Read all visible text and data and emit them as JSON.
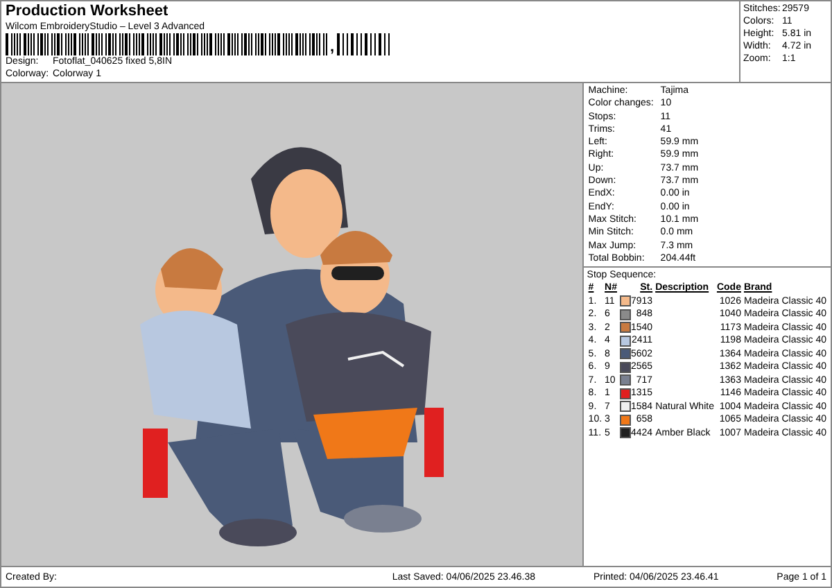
{
  "header": {
    "title": "Production Worksheet",
    "product": "Wilcom EmbroideryStudio – Level 3 Advanced",
    "barcode_separator": ",",
    "fields": [
      {
        "label": "Design:",
        "value": "Fotoflat_040625 fixed 5,8IN"
      },
      {
        "label": "Colorway:",
        "value": "Colorway 1"
      }
    ]
  },
  "summary": [
    {
      "label": "Stitches:",
      "value": "29579"
    },
    {
      "label": "Colors:",
      "value": "11"
    },
    {
      "label": "Height:",
      "value": "5.81 in"
    },
    {
      "label": "Width:",
      "value": "4.72 in"
    },
    {
      "label": "Zoom:",
      "value": "1:1"
    }
  ],
  "details": [
    {
      "label": "Machine:",
      "value": "Tajima"
    },
    {
      "label": "Color changes:",
      "value": "10"
    },
    {
      "label": "Stops:",
      "value": "11"
    },
    {
      "label": "Trims:",
      "value": "41"
    },
    {
      "label": "Left:",
      "value": "59.9 mm"
    },
    {
      "label": "Right:",
      "value": "59.9 mm"
    },
    {
      "label": "Up:",
      "value": "73.7 mm"
    },
    {
      "label": "Down:",
      "value": "73.7 mm"
    },
    {
      "label": "EndX:",
      "value": "0.00 in"
    },
    {
      "label": "EndY:",
      "value": "0.00 in"
    },
    {
      "label": "Max Stitch:",
      "value": "10.1 mm"
    },
    {
      "label": "Min Stitch:",
      "value": "0.0 mm"
    },
    {
      "label": "Max Jump:",
      "value": "7.3 mm"
    },
    {
      "label": "Total Bobbin:",
      "value": "204.44ft"
    }
  ],
  "stop_sequence": {
    "title": "Stop Sequence:",
    "columns": [
      "#",
      "N#",
      "St.",
      "Description",
      "Code",
      "Brand"
    ],
    "rows": [
      {
        "index": "1.",
        "n": "11",
        "color": "#f4b98a",
        "stitches": "7913",
        "description": "",
        "code": "1026",
        "brand": "Madeira Classic 40"
      },
      {
        "index": "2.",
        "n": "6",
        "color": "#8a8a8a",
        "stitches": "848",
        "description": "",
        "code": "1040",
        "brand": "Madeira Classic 40"
      },
      {
        "index": "3.",
        "n": "2",
        "color": "#c87a40",
        "stitches": "1540",
        "description": "",
        "code": "1173",
        "brand": "Madeira Classic 40"
      },
      {
        "index": "4.",
        "n": "4",
        "color": "#b8c8e0",
        "stitches": "2411",
        "description": "",
        "code": "1198",
        "brand": "Madeira Classic 40"
      },
      {
        "index": "5.",
        "n": "8",
        "color": "#4a5a78",
        "stitches": "5602",
        "description": "",
        "code": "1364",
        "brand": "Madeira Classic 40"
      },
      {
        "index": "6.",
        "n": "9",
        "color": "#4a4a5a",
        "stitches": "2565",
        "description": "",
        "code": "1362",
        "brand": "Madeira Classic 40"
      },
      {
        "index": "7.",
        "n": "10",
        "color": "#7a8090",
        "stitches": "717",
        "description": "",
        "code": "1363",
        "brand": "Madeira Classic 40"
      },
      {
        "index": "8.",
        "n": "1",
        "color": "#e02020",
        "stitches": "1315",
        "description": "",
        "code": "1146",
        "brand": "Madeira Classic 40"
      },
      {
        "index": "9.",
        "n": "7",
        "color": "#f0f0f0",
        "stitches": "1584",
        "description": "Natural White",
        "code": "1004",
        "brand": "Madeira Classic 40"
      },
      {
        "index": "10.",
        "n": "3",
        "color": "#f07818",
        "stitches": "658",
        "description": "",
        "code": "1065",
        "brand": "Madeira Classic 40"
      },
      {
        "index": "11.",
        "n": "5",
        "color": "#202020",
        "stitches": "4424",
        "description": "Amber Black",
        "code": "1007",
        "brand": "Madeira Classic 40"
      }
    ]
  },
  "footer": {
    "created_by": "Created By:",
    "last_saved": "Last Saved: 04/06/2025 23.46.38",
    "printed": "Printed: 04/06/2025 23.46.41",
    "page": "Page 1 of 1"
  }
}
